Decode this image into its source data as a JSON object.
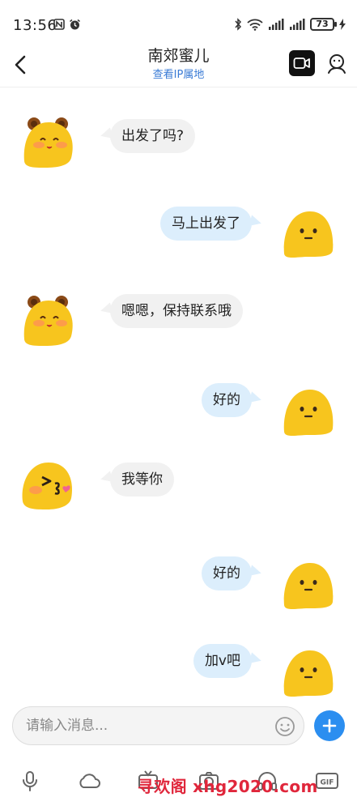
{
  "status_bar": {
    "time": "13:56",
    "battery": "73"
  },
  "header": {
    "contact_name": "南郊蜜儿",
    "ip_link": "查看IP属地",
    "back_icon": "chevron-left-icon",
    "video_icon": "video-call-icon",
    "profile_icon": "profile-icon"
  },
  "messages": [
    {
      "direction": "in",
      "text": "出发了吗?",
      "avatar": "bear-emoji-avatar"
    },
    {
      "direction": "out",
      "text": "马上出发了",
      "avatar": "blob-avatar"
    },
    {
      "direction": "in",
      "text": "嗯嗯，保持联系哦",
      "avatar": "bear-emoji-avatar"
    },
    {
      "direction": "out",
      "text": "好的",
      "avatar": "blob-avatar"
    },
    {
      "direction": "in",
      "text": "我等你",
      "avatar": "kiss-emoji-avatar"
    },
    {
      "direction": "out",
      "text": "好的",
      "avatar": "blob-avatar"
    },
    {
      "direction": "out",
      "text": "加v吧",
      "avatar": "blob-avatar"
    }
  ],
  "input": {
    "placeholder": "请输入消息..."
  },
  "toolbar": {
    "items": [
      "mic-icon",
      "cloud-icon",
      "tv-icon",
      "camera-icon",
      "headset-icon",
      "gif-icon"
    ]
  },
  "watermark": "寻欢阁 xhg2020.com",
  "colors": {
    "accent": "#2b8ef0",
    "outgoing_bubble": "#dceefc",
    "incoming_bubble": "#f1f1f1",
    "avatar_yellow": "#f7c51e",
    "watermark": "#e0263b"
  }
}
